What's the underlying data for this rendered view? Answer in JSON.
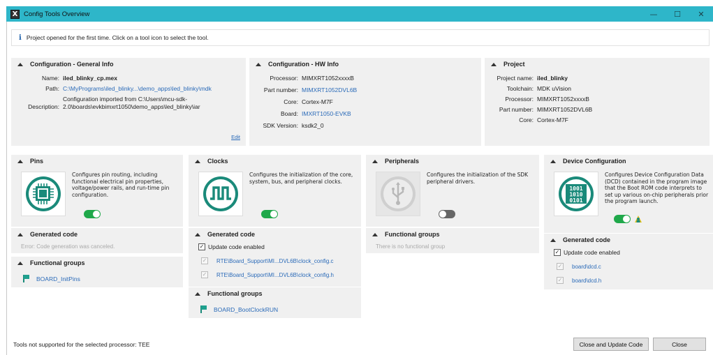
{
  "window": {
    "title": "Config Tools Overview",
    "minimize": "—",
    "maximize": "☐",
    "close": "✕"
  },
  "info": {
    "text": "Project opened for the first time. Click on a tool icon to select the tool."
  },
  "general": {
    "title": "Configuration - General Info",
    "name_label": "Name:",
    "name": "iled_blinky_cp.mex",
    "path_label": "Path:",
    "path": "C:\\MyPrograms\\iled_blinky...\\demo_apps\\led_blinky\\mdk",
    "desc_label": "Description:",
    "desc": "Configuration imported from C:\\Users\\mcu-sdk-2.0\\boards\\evkbimxrt1050\\demo_apps\\led_blinky\\iar",
    "edit_link": "Edit"
  },
  "hw": {
    "title": "Configuration - HW Info",
    "processor_label": "Processor:",
    "processor": "MIMXRT1052xxxxB",
    "part_label": "Part number:",
    "part": "MIMXRT1052DVL6B",
    "core_label": "Core:",
    "core": "Cortex-M7F",
    "board_label": "Board:",
    "board": "IMXRT1050-EVKB",
    "sdk_label": "SDK Version:",
    "sdk": "ksdk2_0"
  },
  "project": {
    "title": "Project",
    "name_label": "Project name:",
    "name": "iled_blinky",
    "toolchain_label": "Toolchain:",
    "toolchain": "MDK uVision",
    "processor_label": "Processor:",
    "processor": "MIMXRT1052xxxxB",
    "part_label": "Part number:",
    "part": "MIMXRT1052DVL6B",
    "core_label": "Core:",
    "core": "Cortex-M7F"
  },
  "pins": {
    "title": "Pins",
    "desc": "Configures pin routing, including functional electrical pin properties, voltage/power rails, and run-time pin configuration.",
    "enabled": true,
    "generated_title": "Generated code",
    "generated_msg": "Error: Code generation was canceled.",
    "groups_title": "Functional groups",
    "group": "BOARD_InitPins"
  },
  "clocks": {
    "title": "Clocks",
    "desc": "Configures the initialization of the core, system, bus, and peripheral clocks.",
    "enabled": true,
    "generated_title": "Generated code",
    "update_label": "Update code enabled",
    "file1": "RTE\\Board_Support\\MI...DVL6B\\clock_config.c",
    "file2": "RTE\\Board_Support\\MI...DVL6B\\clock_config.h",
    "groups_title": "Functional groups",
    "group": "BOARD_BootClockRUN"
  },
  "peripherals": {
    "title": "Peripherals",
    "desc": "Configures the initialization of the SDK peripheral drivers.",
    "enabled": false,
    "groups_title": "Functional groups",
    "groups_msg": "There is no functional group"
  },
  "dcd": {
    "title": "Device Configuration",
    "desc": "Configures Device Configuration Data (DCD) contained in the program image that the Boot ROM code interprets to set up various on-chip peripherals prior the program launch.",
    "icon_text": "1001 1010 0101",
    "enabled": true,
    "generated_title": "Generated code",
    "update_label": "Update code enabled",
    "file1": "board\\dcd.c",
    "file2": "board\\dcd.h"
  },
  "footer": {
    "status": "Tools not supported for the selected processor: TEE",
    "close_update": "Close and Update Code",
    "close": "Close"
  },
  "colors": {
    "titlebar": "#2eb6c9",
    "accent": "#1a8a7a",
    "link": "#2a6ab8",
    "toggle_on": "#1fa84a"
  }
}
